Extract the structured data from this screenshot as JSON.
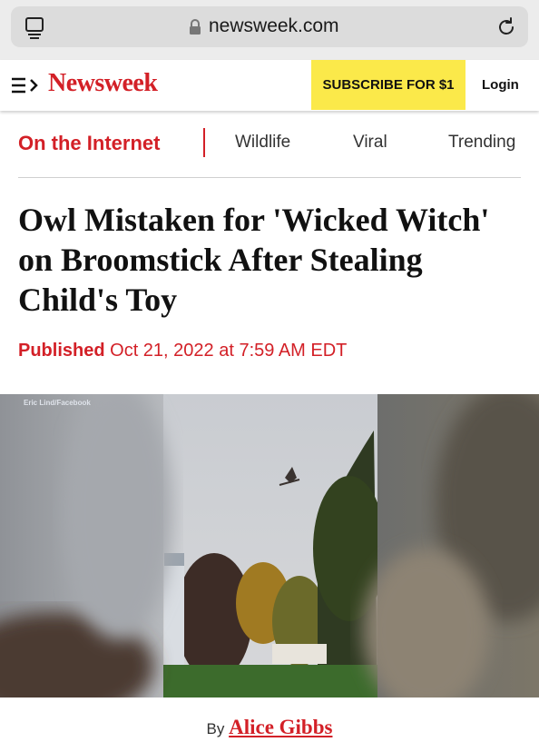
{
  "browser": {
    "url": "newsweek.com",
    "icons": {
      "tabs": "tabs-icon",
      "lock": "lock-icon",
      "reload": "reload-icon"
    }
  },
  "header": {
    "logo": "Newsweek",
    "subscribe_label": "SUBSCRIBE FOR $1",
    "login_label": "Login",
    "colors": {
      "brand": "#d32027",
      "subscribe_bg": "#fbe94a"
    }
  },
  "section_nav": {
    "current": "On the Internet",
    "links": [
      "Wildlife",
      "Viral",
      "Trending"
    ]
  },
  "article": {
    "headline": "Owl Mistaken for 'Wicked Witch' on Broomstick After Stealing Child's Toy",
    "published_label": "Published",
    "published_date": "Oct 21, 2022 at 7:59 AM EDT",
    "image_credit": "Eric Lind/Facebook",
    "byline_prefix": "By",
    "author": "Alice Gibbs"
  }
}
